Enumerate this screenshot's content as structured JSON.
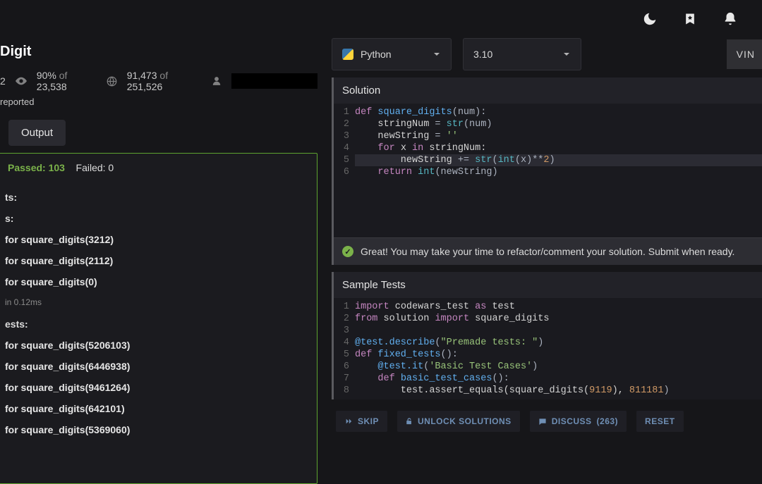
{
  "title": "Digit",
  "stats": {
    "count1": "2",
    "pct": "90%",
    "pct_of_word": "of",
    "pct_total": "23,538",
    "completions": "91,473",
    "completions_of_word": "of",
    "completions_total": "251,526"
  },
  "reported": "reported",
  "tabs": {
    "output": "Output"
  },
  "results": {
    "passed_label": "Passed: 103",
    "failed_label": "Failed: 0",
    "section1": "ts:",
    "sub1": "s:",
    "tests_a": [
      "for square_digits(3212)",
      "for square_digits(2112)",
      "for square_digits(0)"
    ],
    "completed": "in 0.12ms",
    "sub2": "ests:",
    "tests_b": [
      "for square_digits(5206103)",
      "for square_digits(6446938)",
      "for square_digits(9461264)",
      "for square_digits(642101)",
      "for square_digits(5369060)"
    ]
  },
  "selectors": {
    "language": "Python",
    "version": "3.10",
    "vin": "VIN"
  },
  "solution": {
    "header": "Solution",
    "success": "Great! You may take your time to refactor/comment your solution. Submit when ready.",
    "lines": [
      {
        "n": 1,
        "tokens": [
          {
            "t": "def ",
            "c": "kw"
          },
          {
            "t": "square_digits",
            "c": "fn"
          },
          {
            "t": "(num):",
            "c": "op"
          }
        ]
      },
      {
        "n": 2,
        "tokens": [
          {
            "t": "    stringNum ",
            "c": "plain"
          },
          {
            "t": "= ",
            "c": "op"
          },
          {
            "t": "str",
            "c": "bi"
          },
          {
            "t": "(num)",
            "c": "op"
          }
        ]
      },
      {
        "n": 3,
        "tokens": [
          {
            "t": "    newString ",
            "c": "plain"
          },
          {
            "t": "= ",
            "c": "op"
          },
          {
            "t": "''",
            "c": "str"
          }
        ]
      },
      {
        "n": 4,
        "tokens": [
          {
            "t": "    ",
            "c": "plain"
          },
          {
            "t": "for ",
            "c": "kw"
          },
          {
            "t": "x ",
            "c": "plain"
          },
          {
            "t": "in ",
            "c": "kw"
          },
          {
            "t": "stringNum:",
            "c": "plain"
          }
        ]
      },
      {
        "n": 5,
        "hl": true,
        "tokens": [
          {
            "t": "        newString ",
            "c": "plain"
          },
          {
            "t": "+= ",
            "c": "op"
          },
          {
            "t": "str",
            "c": "bi"
          },
          {
            "t": "(",
            "c": "op"
          },
          {
            "t": "int",
            "c": "bi"
          },
          {
            "t": "(x)",
            "c": "op"
          },
          {
            "t": "**",
            "c": "op"
          },
          {
            "t": "2",
            "c": "num"
          },
          {
            "t": ")",
            "c": "op"
          }
        ]
      },
      {
        "n": 6,
        "tokens": [
          {
            "t": "    ",
            "c": "plain"
          },
          {
            "t": "return ",
            "c": "kw"
          },
          {
            "t": "int",
            "c": "bi"
          },
          {
            "t": "(newString)",
            "c": "op"
          }
        ]
      }
    ]
  },
  "tests": {
    "header": "Sample Tests",
    "lines": [
      {
        "n": 1,
        "tokens": [
          {
            "t": "import ",
            "c": "kw"
          },
          {
            "t": "codewars_test ",
            "c": "plain"
          },
          {
            "t": "as ",
            "c": "kw"
          },
          {
            "t": "test",
            "c": "plain"
          }
        ]
      },
      {
        "n": 2,
        "tokens": [
          {
            "t": "from ",
            "c": "kw"
          },
          {
            "t": "solution ",
            "c": "plain"
          },
          {
            "t": "import ",
            "c": "kw"
          },
          {
            "t": "square_digits",
            "c": "plain"
          }
        ]
      },
      {
        "n": 3,
        "tokens": [
          {
            "t": " ",
            "c": "plain"
          }
        ]
      },
      {
        "n": 4,
        "tokens": [
          {
            "t": "@test.describe",
            "c": "fn"
          },
          {
            "t": "(",
            "c": "op"
          },
          {
            "t": "\"Premade tests: \"",
            "c": "str"
          },
          {
            "t": ")",
            "c": "op"
          }
        ]
      },
      {
        "n": 5,
        "tokens": [
          {
            "t": "def ",
            "c": "kw"
          },
          {
            "t": "fixed_tests",
            "c": "fn"
          },
          {
            "t": "():",
            "c": "op"
          }
        ]
      },
      {
        "n": 6,
        "tokens": [
          {
            "t": "    ",
            "c": "plain"
          },
          {
            "t": "@test.it",
            "c": "fn"
          },
          {
            "t": "(",
            "c": "op"
          },
          {
            "t": "'Basic Test Cases'",
            "c": "str"
          },
          {
            "t": ")",
            "c": "op"
          }
        ]
      },
      {
        "n": 7,
        "tokens": [
          {
            "t": "    ",
            "c": "plain"
          },
          {
            "t": "def ",
            "c": "kw"
          },
          {
            "t": "basic_test_cases",
            "c": "fn"
          },
          {
            "t": "():",
            "c": "op"
          }
        ]
      },
      {
        "n": 8,
        "tokens": [
          {
            "t": "        test.assert_equals(square_digits(",
            "c": "plain"
          },
          {
            "t": "9119",
            "c": "num"
          },
          {
            "t": "), ",
            "c": "plain"
          },
          {
            "t": "811181",
            "c": "num"
          },
          {
            "t": ")",
            "c": "op"
          }
        ]
      }
    ]
  },
  "actions": {
    "skip": "SKIP",
    "unlock": "UNLOCK SOLUTIONS",
    "discuss": "DISCUSS",
    "discuss_count": "(263)",
    "reset": "RESET"
  }
}
